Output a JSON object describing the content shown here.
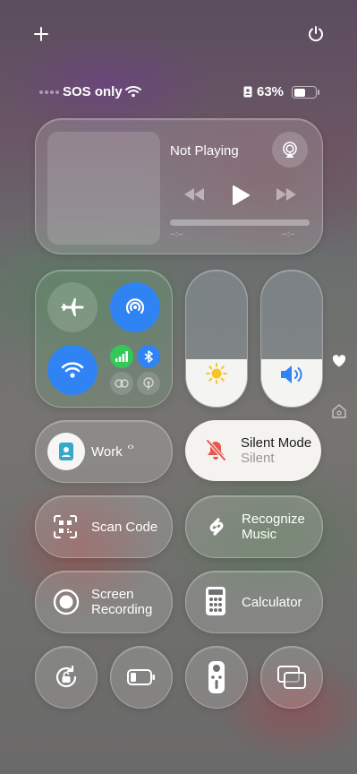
{
  "status_bar": {
    "carrier": "SOS only",
    "battery_percent": "63%",
    "battery_level": 0.63
  },
  "top_controls": {
    "add_icon": "plus-icon",
    "power_icon": "power-icon"
  },
  "now_playing": {
    "title": "Not Playing",
    "elapsed": "--:--",
    "remaining": "--:--"
  },
  "sliders": {
    "brightness_level": 0.35,
    "volume_level": 0.35
  },
  "focus": {
    "label": "Work",
    "chevron": "⌃⌄"
  },
  "silent": {
    "title": "Silent Mode",
    "subtitle": "Silent"
  },
  "scan": {
    "label": "Scan Code"
  },
  "shazam": {
    "label_line1": "Recognize",
    "label_line2": "Music"
  },
  "record": {
    "label_line1": "Screen",
    "label_line2": "Recording"
  },
  "calculator": {
    "label": "Calculator"
  },
  "colors": {
    "blue": "#2f83f3",
    "green": "#34c759"
  }
}
